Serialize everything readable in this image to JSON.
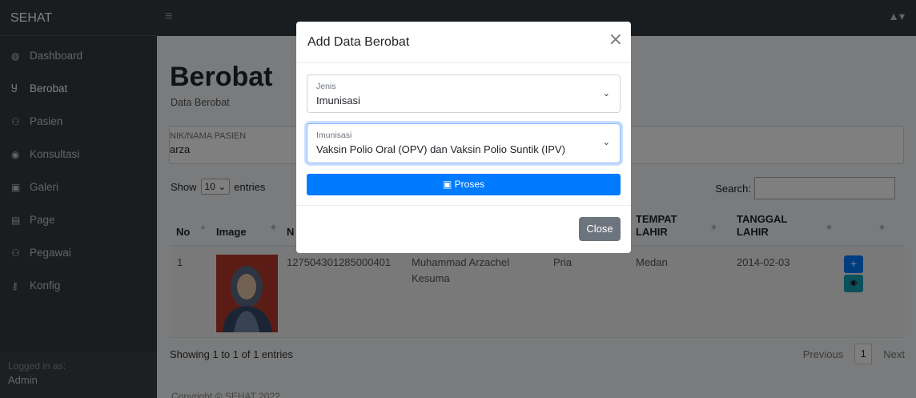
{
  "sidebar": {
    "brand": "SEHAT",
    "items": [
      {
        "icon": "dashboard-icon",
        "glyph": "◍",
        "label": "Dashboard"
      },
      {
        "icon": "stethoscope-icon",
        "glyph": "Ⴘ",
        "label": "Berobat"
      },
      {
        "icon": "users-icon",
        "glyph": "⚇",
        "label": "Pasien"
      },
      {
        "icon": "chat-icon",
        "glyph": "◉",
        "label": "Konsultasi"
      },
      {
        "icon": "gallery-icon",
        "glyph": "▣",
        "label": "Galeri"
      },
      {
        "icon": "page-icon",
        "glyph": "▤",
        "label": "Page"
      },
      {
        "icon": "users-icon",
        "glyph": "⚇",
        "label": "Pegawai"
      },
      {
        "icon": "key-icon",
        "glyph": "⚷",
        "label": "Konfig"
      }
    ],
    "logged_in_label": "Logged in as:",
    "logged_in_user": "Admin"
  },
  "topbar": {
    "menu_glyph": "≡",
    "user_glyph": "▲▾"
  },
  "page": {
    "title": "Berobat",
    "subtitle": "Data Berobat",
    "search_label": "NIK/NAMA PASIEN",
    "search_value": "arza",
    "show_label": "Show",
    "show_value": "10",
    "entries_label": "entries",
    "search_table_label": "Search:"
  },
  "table": {
    "columns": [
      "No",
      "Image",
      "N",
      "",
      "",
      "TEMPAT\nLAHIR",
      "TANGGAL\nLAHIR"
    ],
    "rows": [
      {
        "no": "1",
        "nik": "127504301285000401",
        "nama": "Muhammad Arzachel Kesuma",
        "jk": "Pria",
        "tempat": "Medan",
        "tanggal": "2014-02-03"
      }
    ],
    "showing": "Showing 1 to 1 of 1 entries",
    "prev": "Previous",
    "page": "1",
    "next": "Next"
  },
  "copyright": "Copyright © SEHAT 2022",
  "modal": {
    "title": "Add Data Berobat",
    "close_glyph": "×",
    "jenis_label": "Jenis",
    "jenis_value": "Imunisasi",
    "imunisasi_label": "Imunisasi",
    "imunisasi_value": "Vaksin Polio Oral (OPV) dan Vaksin Polio Suntik (IPV)",
    "proses_label": "Proses",
    "close_label": "Close"
  },
  "colors": {
    "sidebar": "#343a40",
    "primary": "#007bff",
    "info": "#17a2b8",
    "secondary": "#6c757d"
  }
}
